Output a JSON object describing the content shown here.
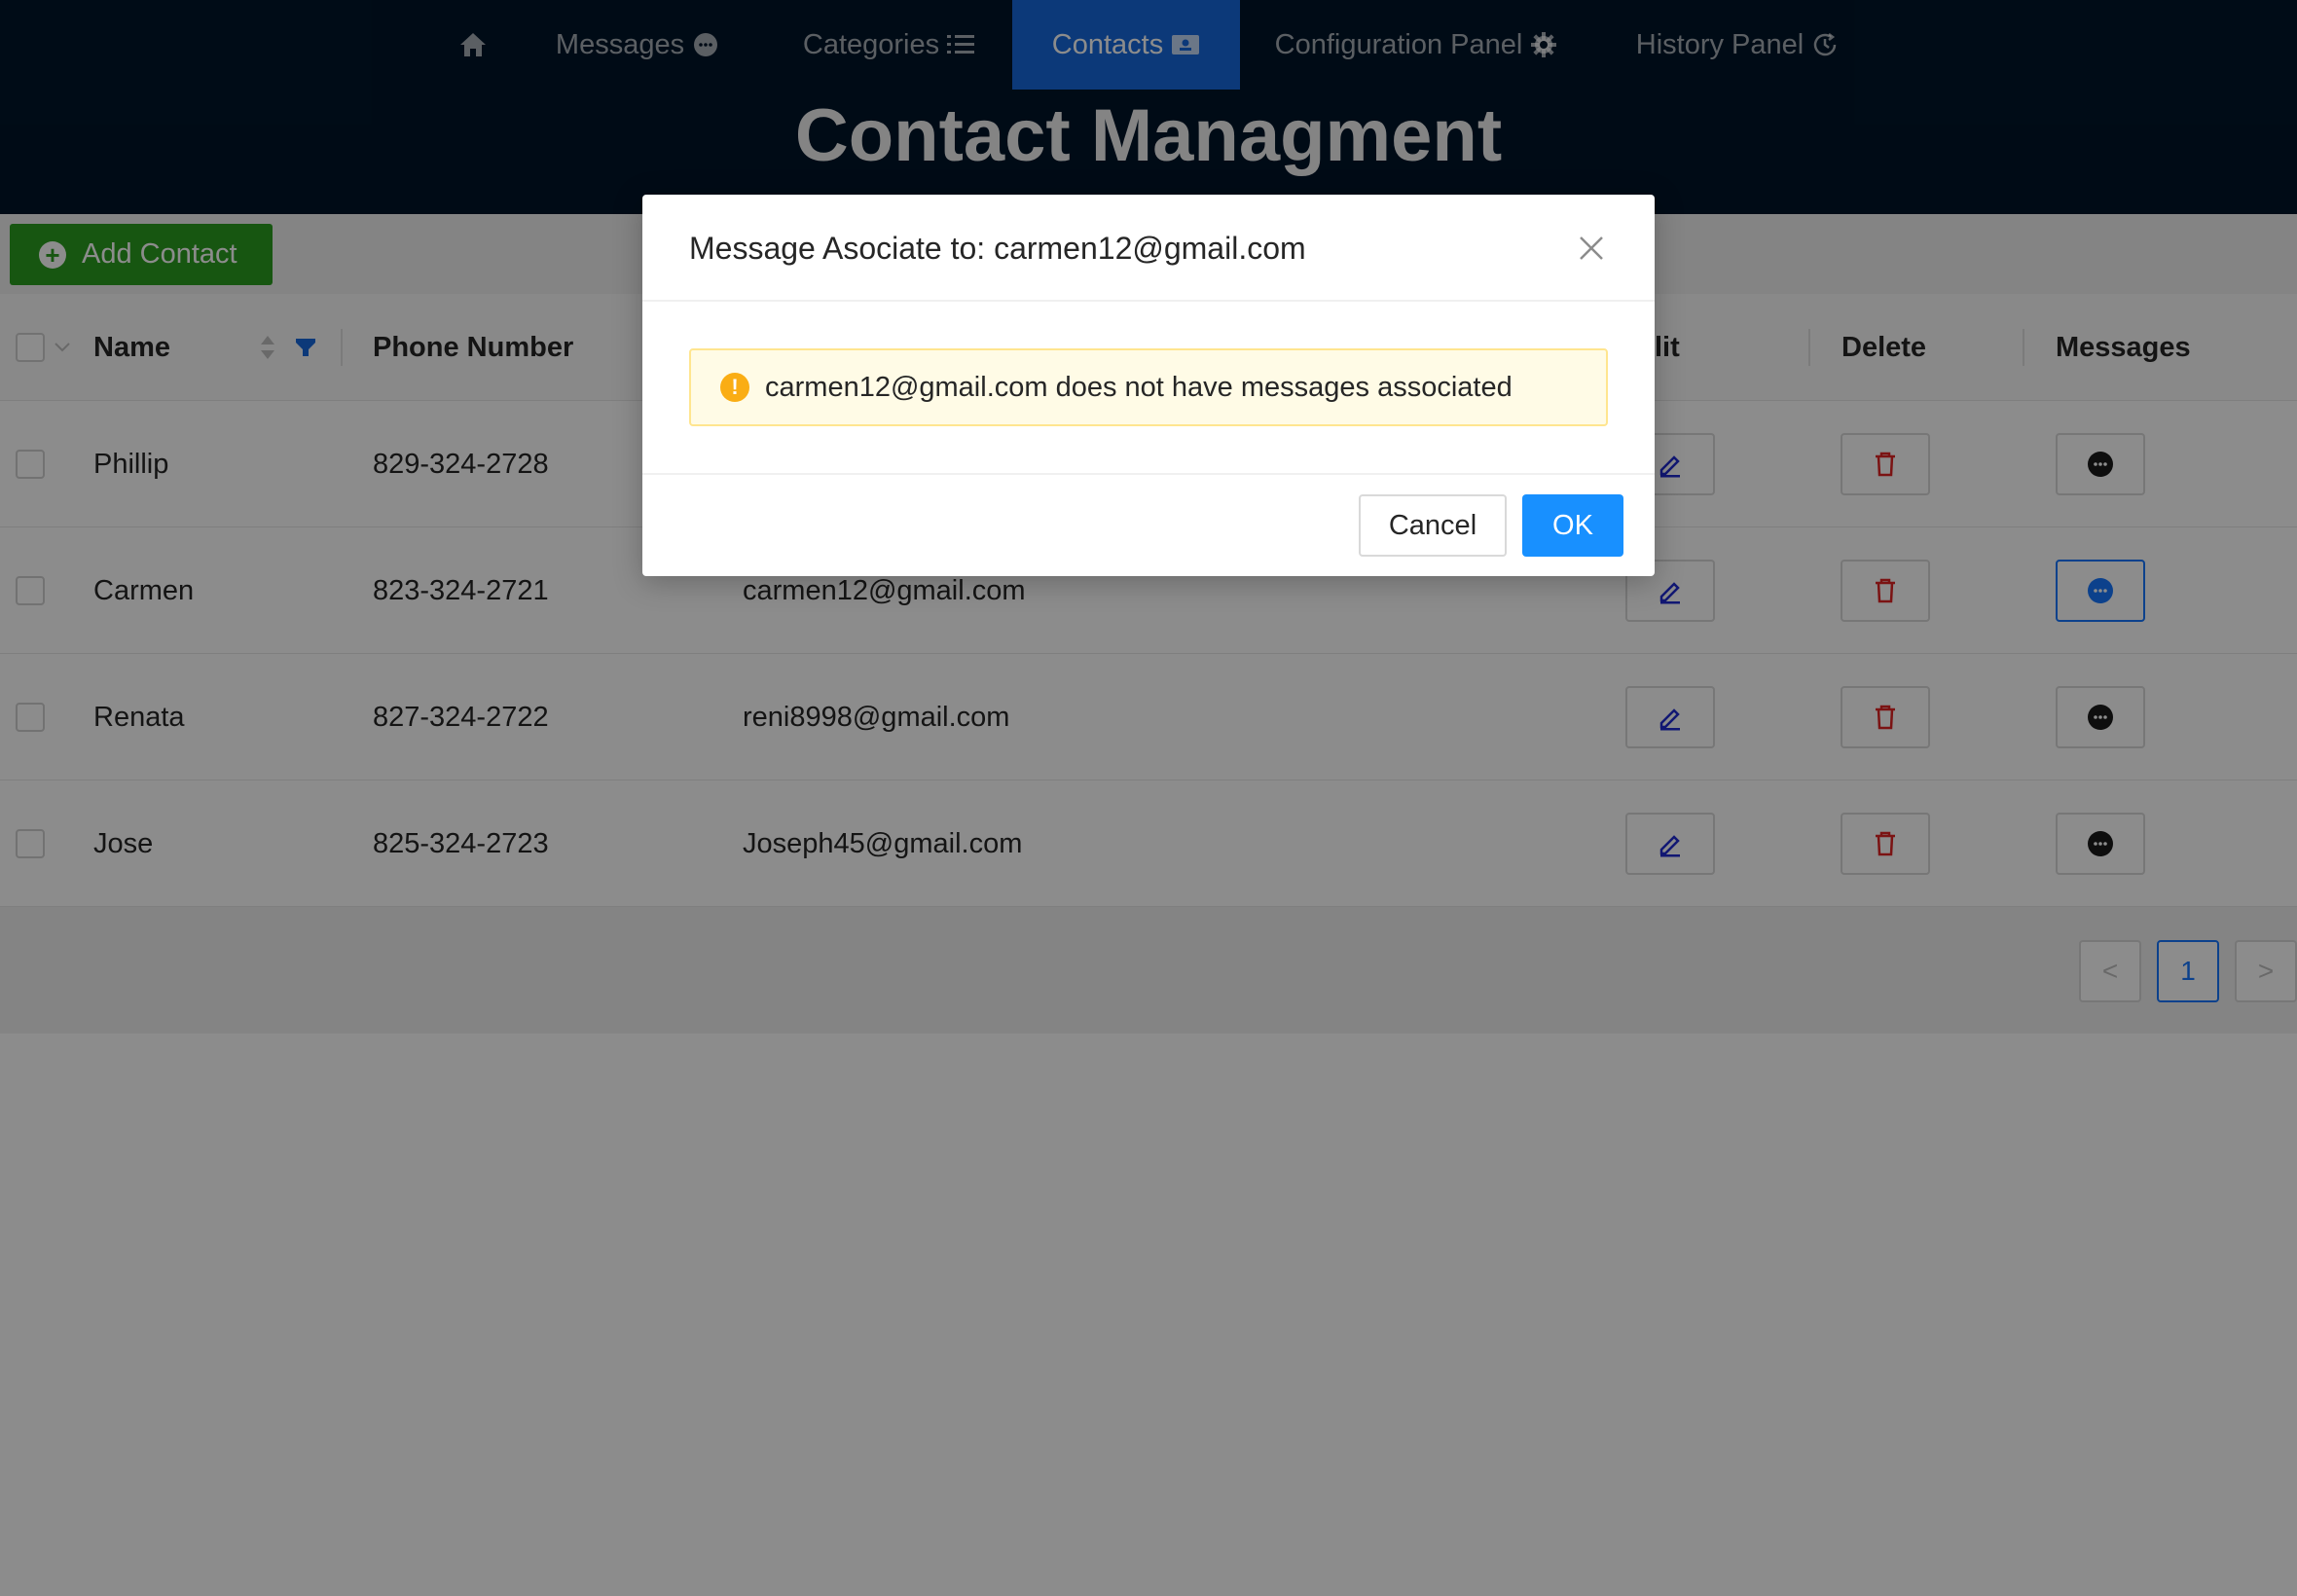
{
  "nav": {
    "items": [
      {
        "label": "",
        "icon": "home-icon"
      },
      {
        "label": "Messages",
        "icon": "message-icon"
      },
      {
        "label": "Categories",
        "icon": "list-icon"
      },
      {
        "label": "Contacts",
        "icon": "contacts-card-icon",
        "active": true
      },
      {
        "label": "Configuration Panel",
        "icon": "gear-icon"
      },
      {
        "label": "History Panel",
        "icon": "history-icon"
      }
    ]
  },
  "page_title": "Contact Managment",
  "toolbar": {
    "add_label": "Add Contact"
  },
  "table": {
    "headers": {
      "name": "Name",
      "phone": "Phone Number",
      "edit": "lit",
      "delete": "Delete",
      "messages": "Messages"
    },
    "rows": [
      {
        "name": "Phillip",
        "phone": "829-324-2728",
        "email": ""
      },
      {
        "name": "Carmen",
        "phone": "823-324-2721",
        "email": "carmen12@gmail.com"
      },
      {
        "name": "Renata",
        "phone": "827-324-2722",
        "email": "reni8998@gmail.com"
      },
      {
        "name": "Jose",
        "phone": "825-324-2723",
        "email": "Joseph45@gmail.com"
      }
    ]
  },
  "pagination": {
    "current_page": "1",
    "prev": "<",
    "next": ">"
  },
  "modal": {
    "title": "Message Asociate to: carmen12@gmail.com",
    "alert_text": "carmen12@gmail.com does not have messages associated",
    "cancel_label": "Cancel",
    "ok_label": "OK"
  },
  "colors": {
    "header_bg": "#001529",
    "nav_active": "#1668dc",
    "add_button": "#2a9d1f",
    "primary": "#1890ff",
    "delete_icon": "#e02424",
    "edit_icon": "#1f2bd1",
    "warning": "#faad14"
  }
}
